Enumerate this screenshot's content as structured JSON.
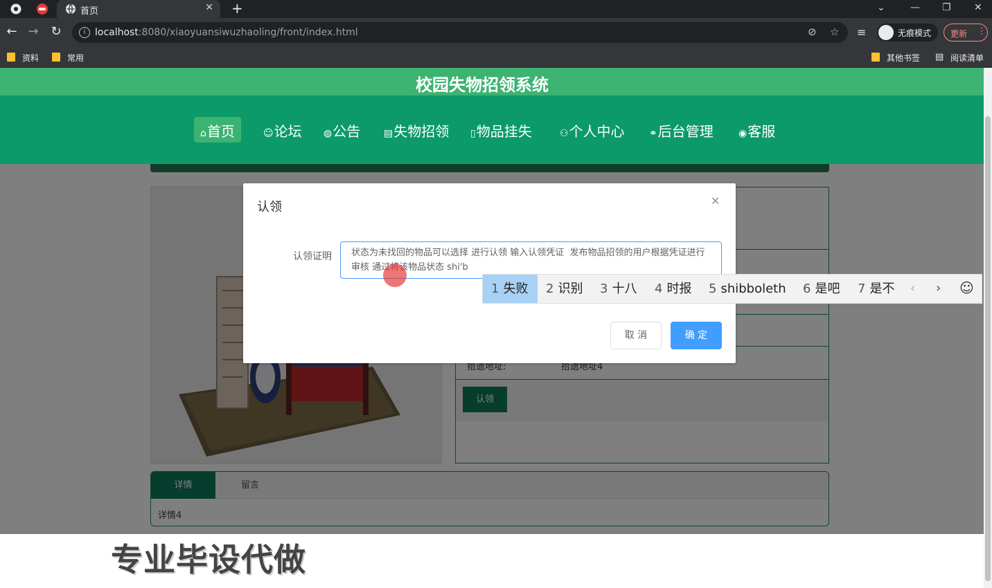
{
  "browser": {
    "tab_title": "首页",
    "url_host": "localhost",
    "url_path": ":8080/xiaoyuansiwuzhaoling/front/index.html",
    "profile_label": "无痕模式",
    "update_label": "更新",
    "bookmarks": [
      "资料",
      "常用"
    ],
    "other_bookmarks": "其他书签",
    "reading_list": "阅读清单"
  },
  "site": {
    "title": "校园失物招领系统",
    "nav": [
      {
        "icon": "⌂",
        "label": "首页"
      },
      {
        "icon": "☺",
        "label": "论坛"
      },
      {
        "icon": "◍",
        "label": "公告"
      },
      {
        "icon": "▤",
        "label": "失物招领"
      },
      {
        "icon": "▯",
        "label": "物品挂失"
      },
      {
        "icon": "⚇",
        "label": "个人中心"
      },
      {
        "icon": "⚭",
        "label": "后台管理"
      },
      {
        "icon": "◉",
        "label": "客服"
      }
    ]
  },
  "detail": {
    "address_label": "拾遗地址:",
    "address_value": "拾遗地址4",
    "claim_button": "认领",
    "tabs": [
      "详情",
      "留言"
    ],
    "detail_text": "详情4"
  },
  "dialog": {
    "title": "认领",
    "form_label": "认领证明",
    "proof_value": "状态为未找回的物品可以选择 进行认领 输入认领凭证  发布物品招领的用户根据凭证进行审核 通过将该物品状态 shi'b",
    "cancel": "取 消",
    "confirm": "确 定"
  },
  "ime": {
    "candidates": [
      {
        "num": "1",
        "text": "失败"
      },
      {
        "num": "2",
        "text": "识别"
      },
      {
        "num": "3",
        "text": "十八"
      },
      {
        "num": "4",
        "text": "时报"
      },
      {
        "num": "5",
        "text": "shibboleth"
      },
      {
        "num": "6",
        "text": "是吧"
      },
      {
        "num": "7",
        "text": "是不"
      }
    ]
  },
  "watermark": "专业毕设代做",
  "colors": {
    "header": "#3cb371",
    "nav": "#0c9a6a",
    "primary": "#409eff",
    "accent": "#0c7a5a"
  }
}
